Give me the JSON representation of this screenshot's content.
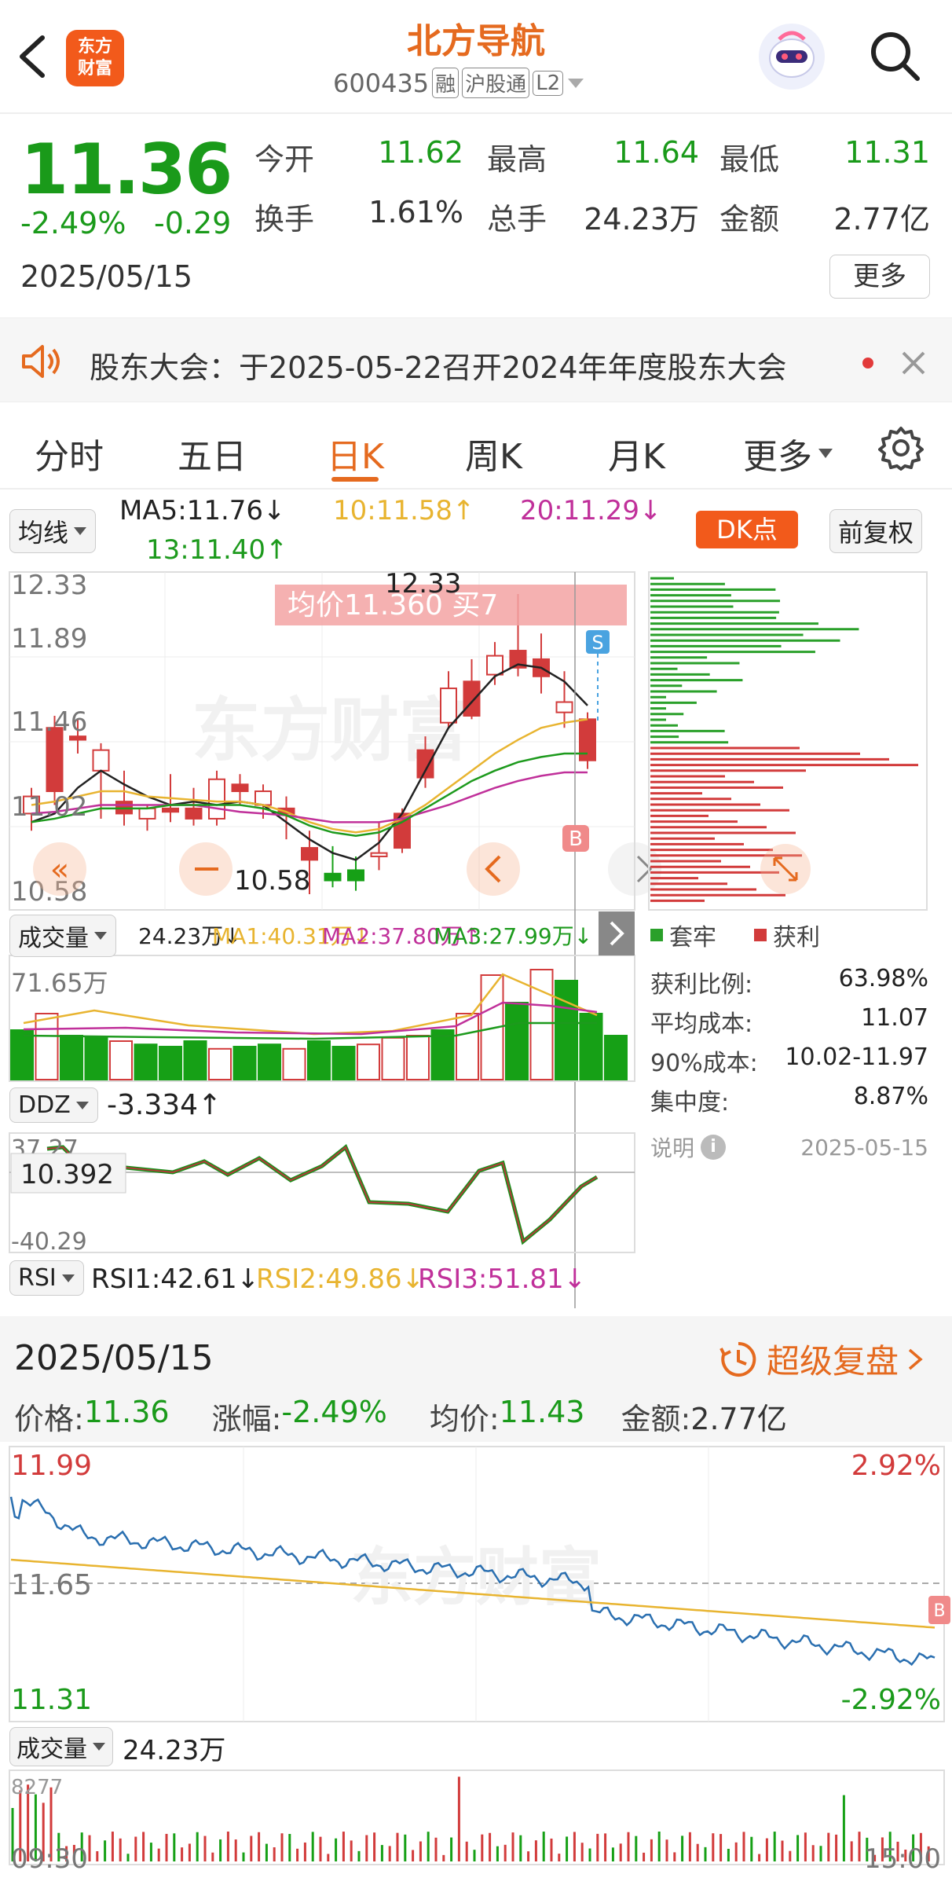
{
  "header": {
    "back_icon": "chevron-left-icon",
    "logo_text": "东方\n财富",
    "title": "北方导航",
    "code": "600435",
    "badges": [
      "融",
      "沪股通",
      "L2"
    ],
    "avatar_icon": "robot-avatar-icon",
    "search_icon": "search-icon"
  },
  "quote": {
    "price": "11.36",
    "change_pct": "-2.49%",
    "change": "-0.29",
    "date": "2025/05/15",
    "fields": [
      {
        "label": "今开",
        "value": "11.62"
      },
      {
        "label": "最高",
        "value": "11.64"
      },
      {
        "label": "最低",
        "value": "11.31"
      },
      {
        "label": "换手",
        "value": "1.61%"
      },
      {
        "label": "总手",
        "value": "24.23万"
      },
      {
        "label": "金额",
        "value": "2.77亿"
      }
    ],
    "more_label": "更多"
  },
  "notice": {
    "text": "股东大会：于2025-05-22召开2024年年度股东大会"
  },
  "tabs": {
    "items": [
      "分时",
      "五日",
      "日K",
      "周K",
      "月K",
      "更多"
    ],
    "active": "日K",
    "settings_icon": "gear-icon"
  },
  "indicators": {
    "ma_selector": "均线",
    "ma5": "MA5:11.76↓",
    "ma10": "10:11.58↑",
    "ma20": "20:11.29↓",
    "ma13": "13:11.40↑",
    "dk_button": "DK点",
    "fq_button": "前复权"
  },
  "kline": {
    "price_ticks": [
      "12.33",
      "11.89",
      "11.46",
      "11.02",
      "10.58"
    ],
    "tooltip": "均价11.360  买7",
    "high_label": "12.33",
    "low_label": "10.58",
    "marker_s": "S",
    "marker_b": "B",
    "watermark": "东方财富",
    "colors": {
      "up": "#d23b3b",
      "down": "#16a016",
      "ma5": "#222222",
      "ma10": "#e8b430",
      "ma20": "#c0309a",
      "ma13": "#1d9a1d"
    }
  },
  "volume": {
    "selector": "成交量",
    "vol": "24.23万↓",
    "ma1": "MA1:40.31万↓",
    "ma2": "MA2:37.80万↑",
    "ma3": "MA3:27.99万↓",
    "max_label": "71.65万"
  },
  "ddz": {
    "selector": "DDZ",
    "value": "-3.334↑",
    "top": "37.27",
    "bottom": "-40.29",
    "crosshair_value": "10.392"
  },
  "rsi": {
    "selector": "RSI",
    "rsi1": "RSI1:42.61↓",
    "rsi2": "RSI2:49.86↓",
    "rsi3": "RSI3:51.81↓"
  },
  "chip": {
    "legend_trapped": "套牢",
    "legend_profit": "获利",
    "rows": [
      {
        "label": "获利比例:",
        "value": "63.98%"
      },
      {
        "label": "平均成本:",
        "value": "11.07"
      },
      {
        "label": "90%成本:",
        "value": "10.02-11.97"
      },
      {
        "label": "集中度:",
        "value": "8.87%"
      }
    ],
    "note_label": "说明",
    "note_date": "2025-05-15"
  },
  "daybar": {
    "date": "2025/05/15",
    "super_review": "超级复盘",
    "price_label": "价格:",
    "price": "11.36",
    "pct_label": "涨幅:",
    "pct": "-2.49%",
    "avg_label": "均价:",
    "avg": "11.43",
    "amount_label": "金额:",
    "amount": "2.77亿"
  },
  "intraday": {
    "top_price": "11.99",
    "top_pct": "2.92%",
    "ref_price": "11.65",
    "bottom_price": "11.31",
    "bottom_pct": "-2.92%",
    "vol_selector": "成交量",
    "vol": "24.23万",
    "vol_max": "8277",
    "time_start": "09:30",
    "time_end": "15:00"
  }
}
